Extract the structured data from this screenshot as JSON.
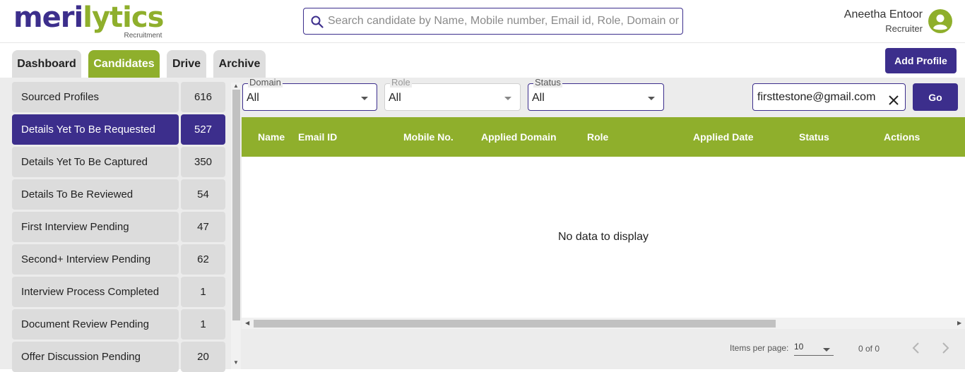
{
  "logo": {
    "part1": "meri",
    "part2": "lytics",
    "sub": "Recruitment",
    "colors": {
      "primary": "#3c2e8c",
      "accent": "#8faf2c"
    }
  },
  "search": {
    "placeholder": "Search candidate by Name, Mobile number, Email id, Role, Domain or S",
    "icon": "search-icon"
  },
  "user": {
    "name": "Aneetha Entoor",
    "role": "Recruiter",
    "icon": "account-circle-icon"
  },
  "tabs": [
    {
      "label": "Dashboard",
      "active": false
    },
    {
      "label": "Candidates",
      "active": true
    },
    {
      "label": "Drive",
      "active": false
    },
    {
      "label": "Archive",
      "active": false
    }
  ],
  "add_profile_label": "Add Profile",
  "stats": [
    {
      "label": "Sourced Profiles",
      "count": "616"
    },
    {
      "label": "Details Yet To Be Requested",
      "count": "527",
      "active": true
    },
    {
      "label": "Details Yet To Be Captured",
      "count": "350"
    },
    {
      "label": "Details To Be Reviewed",
      "count": "54"
    },
    {
      "label": "First Interview Pending",
      "count": "47"
    },
    {
      "label": "Second+ Interview Pending",
      "count": "62"
    },
    {
      "label": "Interview Process Completed",
      "count": "1"
    },
    {
      "label": "Document Review Pending",
      "count": "1"
    },
    {
      "label": "Offer Discussion Pending",
      "count": "20"
    }
  ],
  "filters": {
    "domain": {
      "label": "Domain",
      "value": "All"
    },
    "role": {
      "label": "Role",
      "value": "All"
    },
    "status": {
      "label": "Status",
      "value": "All"
    },
    "email_value": "firsttestone@gmail.com",
    "go_label": "Go"
  },
  "table": {
    "columns": [
      "Name",
      "Email ID",
      "Mobile No.",
      "Applied Domain",
      "Role",
      "Applied Date",
      "Status",
      "Actions"
    ],
    "empty_message": "No data to display"
  },
  "paginator": {
    "items_label": "Items per page:",
    "page_size": "10",
    "range": "0 of 0"
  }
}
